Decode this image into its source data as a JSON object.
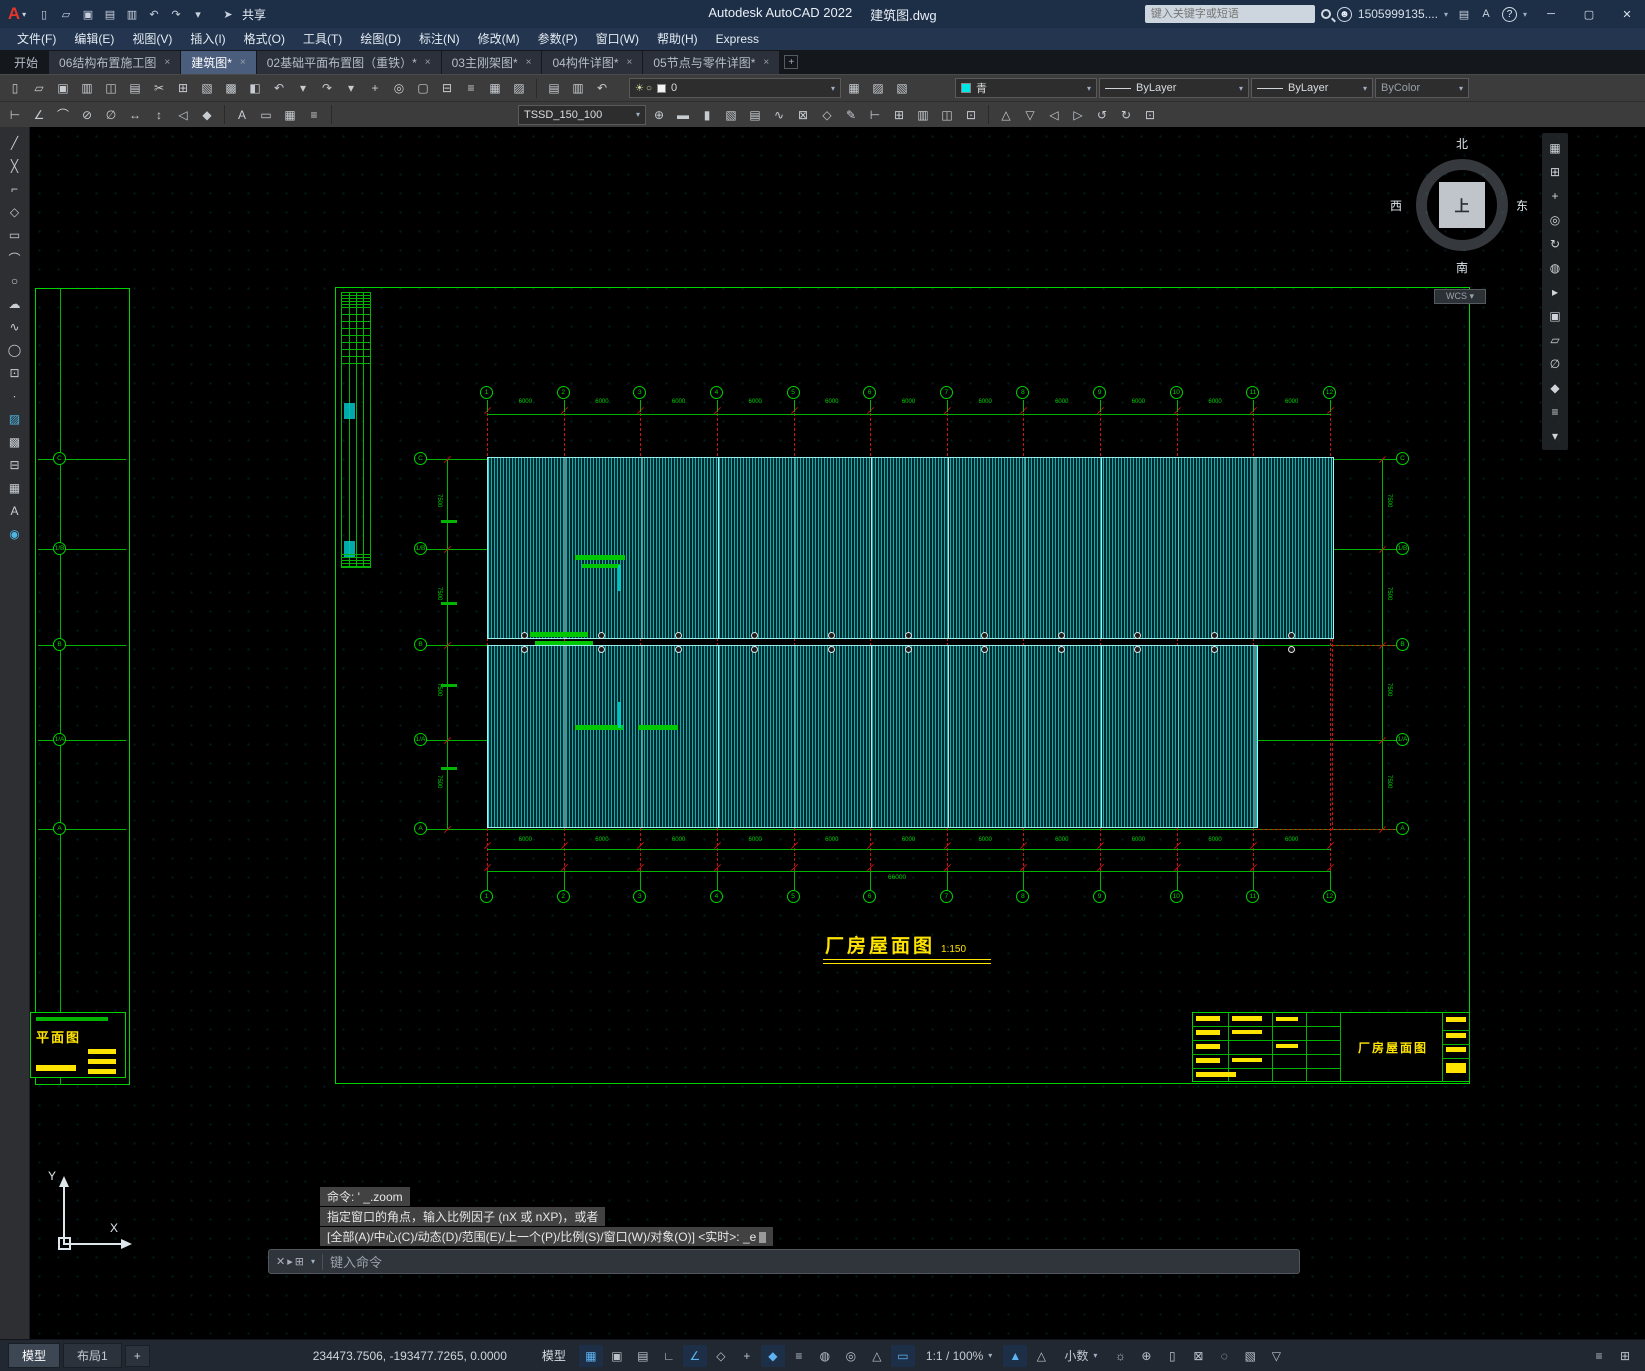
{
  "app": {
    "logo_letter": "A",
    "title": "Autodesk AutoCAD 2022",
    "file": "建筑图.dwg",
    "share_label": "共享",
    "search_placeholder": "键入关键字或短语",
    "user": "1505999135...."
  },
  "menus": [
    "文件(F)",
    "编辑(E)",
    "视图(V)",
    "插入(I)",
    "格式(O)",
    "工具(T)",
    "绘图(D)",
    "标注(N)",
    "修改(M)",
    "参数(P)",
    "窗口(W)",
    "帮助(H)",
    "Express"
  ],
  "file_tabs": [
    {
      "label": "开始",
      "closable": false,
      "active": false,
      "start": true
    },
    {
      "label": "06结构布置施工图",
      "closable": true,
      "active": false
    },
    {
      "label": "建筑图*",
      "closable": true,
      "active": true
    },
    {
      "label": "02基础平面布置图（重铁）*",
      "closable": true,
      "active": false
    },
    {
      "label": "03主刚架图*",
      "closable": true,
      "active": false
    },
    {
      "label": "04构件详图*",
      "closable": true,
      "active": false
    },
    {
      "label": "05节点与零件详图*",
      "closable": true,
      "active": false
    }
  ],
  "toolbar1": {
    "layer_value": "0",
    "color_value": "青",
    "linetype": "ByLayer",
    "lineweight": "ByLayer",
    "plotstyle": "ByColor"
  },
  "toolbar2": {
    "text_style": "TSSD_150_100"
  },
  "viewcube": {
    "n": "北",
    "s": "南",
    "w": "西",
    "e": "东",
    "center": "上",
    "wcs": "WCS"
  },
  "command": {
    "lines": [
      "命令: ' _.zoom",
      "指定窗口的角点，输入比例因子 (nX 或 nXP)，或者",
      "[全部(A)/中心(C)/动态(D)/范围(E)/上一个(P)/比例(S)/窗口(W)/对象(O)] <实时>: _e"
    ],
    "placeholder": "键入命令"
  },
  "statusbar": {
    "tabs": [
      "模型",
      "布局1",
      "+"
    ],
    "coords": "234473.7506, -193477.7265, 0.0000",
    "space_toggle": "模型",
    "scale": "1:1 / 100%",
    "units": "小数"
  },
  "drawing": {
    "main_title": "厂房屋面图",
    "main_scale": "1:150",
    "titleblock_name": "厂房屋面图",
    "left_title": "平面图",
    "grid_cols": [
      "1",
      "2",
      "3",
      "4",
      "5",
      "6",
      "7",
      "8",
      "9",
      "10",
      "11",
      "12"
    ],
    "grid_rows": [
      "C",
      "1/B",
      "B",
      "1/A",
      "A"
    ],
    "bay_dim": "6000",
    "row_dim": "7500",
    "total_dim": "66000"
  },
  "icons": {
    "qat": [
      [
        "new-file-icon",
        "▯"
      ],
      [
        "open-file-icon",
        "▱"
      ],
      [
        "save-icon",
        "▣"
      ],
      [
        "save-as-icon",
        "▤"
      ],
      [
        "plot-icon",
        "▥"
      ],
      [
        "undo-icon",
        "↶"
      ],
      [
        "redo-icon",
        "↷"
      ],
      [
        "qat-customize-icon",
        "▾"
      ]
    ],
    "share": [
      [
        "share-plane-icon",
        "➤"
      ]
    ],
    "title_right": [
      [
        "cart-icon",
        "▤"
      ],
      [
        "apps-icon",
        "A"
      ]
    ],
    "window": [
      [
        "minimize-button",
        "─"
      ],
      [
        "maximize-button",
        "▢"
      ],
      [
        "close-button",
        "✕"
      ]
    ],
    "tb1a": [
      [
        "new-icon",
        "▯"
      ],
      [
        "open-icon",
        "▱"
      ],
      [
        "save-icon",
        "▣"
      ],
      [
        "plot-icon",
        "▥"
      ],
      [
        "preview-icon",
        "◫"
      ],
      [
        "publish-icon",
        "▤"
      ],
      [
        "cut-icon",
        "✂"
      ],
      [
        "copy-icon",
        "⊞"
      ],
      [
        "paste-icon",
        "▧"
      ],
      [
        "match-properties-icon",
        "▩"
      ],
      [
        "block-editor-icon",
        "◧"
      ],
      [
        "undo-icon",
        "↶"
      ],
      [
        "undo-list-icon",
        "▾"
      ],
      [
        "redo-icon",
        "↷"
      ],
      [
        "redo-list-icon",
        "▾"
      ],
      [
        "pan-icon",
        "+"
      ],
      [
        "zoom-realtime-icon",
        "◎"
      ],
      [
        "zoom-window-icon",
        "▢"
      ],
      [
        "zoom-previous-icon",
        "⊟"
      ],
      [
        "properties-icon",
        "≡"
      ],
      [
        "designcenter-icon",
        "▦"
      ],
      [
        "tool-palettes-icon",
        "▨"
      ]
    ],
    "tb1_layer_tools": [
      [
        "layer-properties-icon",
        "▤"
      ],
      [
        "layer-match-icon",
        "▥"
      ],
      [
        "layer-previous-icon",
        "↶"
      ]
    ],
    "layer_dd_icons": [
      [
        "layer-on-icon",
        "☀"
      ],
      [
        "layer-freeze-icon",
        "○"
      ]
    ],
    "tb1b": [
      [
        "make-current-layer-icon",
        "▦"
      ],
      [
        "layer-state-icon",
        "▨"
      ],
      [
        "layer-walk-icon",
        "▧"
      ]
    ],
    "tb2a": [
      [
        "dim-linear-icon",
        "⊢"
      ],
      [
        "dim-aligned-icon",
        "∠"
      ],
      [
        "dim-angular-icon",
        "⌒"
      ],
      [
        "dim-radius-icon",
        "⊘"
      ],
      [
        "dim-diameter-icon",
        "∅"
      ],
      [
        "dim-continue-icon",
        "↔"
      ],
      [
        "dim-baseline-icon",
        "↕"
      ],
      [
        "dim-leader-icon",
        "◁"
      ],
      [
        "dim-style-icon",
        "◆"
      ]
    ],
    "tb2b": [
      [
        "text-icon",
        "A"
      ],
      [
        "mtext-icon",
        "▭"
      ],
      [
        "table-icon",
        "▦"
      ],
      [
        "field-icon",
        "≡"
      ]
    ],
    "tb2c": [
      [
        "tssd-axis-icon",
        "⊕"
      ],
      [
        "tssd-beam-icon",
        "▬"
      ],
      [
        "tssd-column-icon",
        "▮"
      ],
      [
        "tssd-slab-icon",
        "▧"
      ],
      [
        "tssd-stair-icon",
        "▤"
      ],
      [
        "tssd-rebar-icon",
        "∿"
      ],
      [
        "tssd-section-icon",
        "⊠"
      ],
      [
        "tssd-detail-icon",
        "◇"
      ],
      [
        "tssd-text-icon",
        "✎"
      ],
      [
        "tssd-dim-icon",
        "⊢"
      ],
      [
        "tssd-grid-icon",
        "⊞"
      ],
      [
        "tssd-wall-icon",
        "▥"
      ],
      [
        "tssd-door-icon",
        "◫"
      ],
      [
        "tssd-window-icon",
        "⊡"
      ]
    ],
    "tb2d": [
      [
        "layout-icon",
        "△"
      ],
      [
        "view-icon",
        "▽"
      ],
      [
        "prev-view-icon",
        "◁"
      ],
      [
        "next-view-icon",
        "▷"
      ],
      [
        "refresh-icon",
        "↺"
      ],
      [
        "regen-icon",
        "↻"
      ],
      [
        "settings-icon",
        "⊡"
      ]
    ],
    "left_tools": [
      [
        "line-icon",
        "╱"
      ],
      [
        "xline-icon",
        "╳"
      ],
      [
        "polyline-icon",
        "⌐"
      ],
      [
        "polygon-icon",
        "◇"
      ],
      [
        "rectangle-icon",
        "▭"
      ],
      [
        "arc-icon",
        "⌒"
      ],
      [
        "circle-icon",
        "○"
      ],
      [
        "revcloud-icon",
        "☁"
      ],
      [
        "spline-icon",
        "∿"
      ],
      [
        "ellipse-icon",
        "◯"
      ],
      [
        "insert-block-icon",
        "⊡"
      ],
      [
        "point-icon",
        "∙"
      ],
      [
        "hatch-icon",
        "▨",
        1
      ],
      [
        "gradient-icon",
        "▩"
      ],
      [
        "region-icon",
        "⊟"
      ],
      [
        "table-icon",
        "▦"
      ],
      [
        "mtext-icon",
        "A"
      ],
      [
        "point-style-icon",
        "◉",
        1
      ]
    ],
    "nav": [
      [
        "navbar-grid-icon",
        "▦"
      ],
      [
        "fullscreen-icon",
        "⊞"
      ],
      [
        "pan-hand-icon",
        "+"
      ],
      [
        "zoom-icon",
        "◎"
      ],
      [
        "orbit-icon",
        "↻"
      ],
      [
        "steering-wheel-icon",
        "◍"
      ],
      [
        "showmotion-icon",
        "▸"
      ],
      [
        "zoom-extents-icon",
        "▣"
      ],
      [
        "section-icon",
        "▱"
      ],
      [
        "measure-icon",
        "∅"
      ],
      [
        "ucs-world-icon",
        "◆"
      ],
      [
        "nav-settings-icon",
        "≡"
      ],
      [
        "nav-more-icon",
        "▾"
      ]
    ],
    "status_a": [
      [
        "grid-icon",
        "▦",
        1
      ],
      [
        "snap-icon",
        "▣"
      ],
      [
        "infer-constraints-icon",
        "▤"
      ],
      [
        "ortho-icon",
        "∟"
      ],
      [
        "polar-tracking-icon",
        "∠",
        1
      ],
      [
        "isodraft-icon",
        "◇"
      ],
      [
        "object-snap-tracking-icon",
        "+"
      ],
      [
        "osnap-icon",
        "◆",
        1
      ],
      [
        "lineweight-icon",
        "≡"
      ],
      [
        "transparency-icon",
        "◍"
      ],
      [
        "selection-cycling-icon",
        "◎"
      ],
      [
        "dynamic-ucs-icon",
        "△"
      ],
      [
        "dynamic-input-icon",
        "▭",
        1
      ]
    ],
    "status_b": [
      [
        "annotation-visibility-icon",
        "▲",
        1
      ],
      [
        "annotation-autoscale-icon",
        "△"
      ]
    ],
    "status_c": [
      [
        "workspace-icon",
        "☼"
      ],
      [
        "annotation-monitor-icon",
        "⊕"
      ],
      [
        "quick-properties-icon",
        "▯"
      ],
      [
        "lock-ui-icon",
        "⊠"
      ],
      [
        "isolate-objects-icon",
        "◌"
      ],
      [
        "graphics-performance-icon",
        "▧"
      ],
      [
        "filter-icon",
        "▽"
      ]
    ],
    "status_d": [
      [
        "customization-icon",
        "≡"
      ],
      [
        "clean-screen-icon",
        "⊞"
      ]
    ],
    "cmd": [
      [
        "command-close-icon",
        "✕"
      ],
      [
        "command-suggest-icon",
        "▸"
      ],
      [
        "command-customize-icon",
        "⊞"
      ]
    ]
  }
}
